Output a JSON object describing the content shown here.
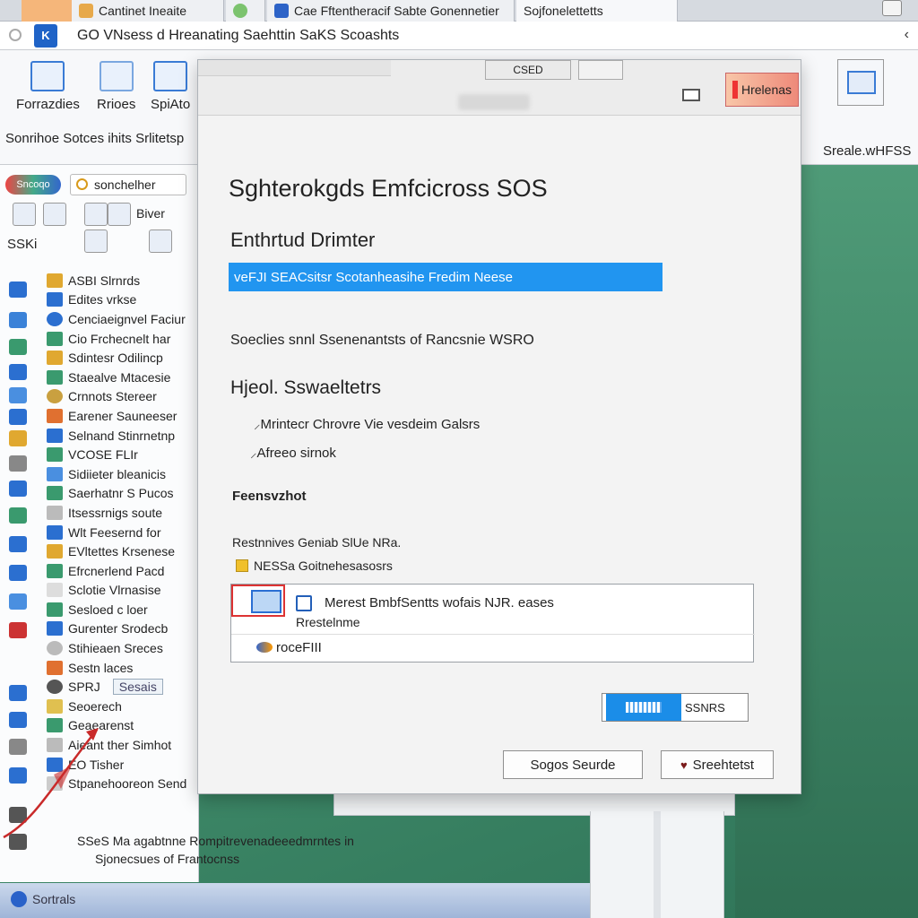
{
  "tabs": [
    {
      "label": "Cantinet Ineaite"
    },
    {
      "label": "Cae Fftentheracif Sabte Gonennetier"
    },
    {
      "label": "Sojfonelettetts"
    }
  ],
  "window": {
    "title": "GO VNsess d Hreanating Saehttin SaKS Scoashts",
    "icon_label": "K"
  },
  "ribbon": {
    "buttons": [
      {
        "label": "Forrazdies"
      },
      {
        "label": "Rrioes"
      },
      {
        "label": "SpiAto"
      }
    ],
    "subtitle": "Sonrihoe Sotces ihits Srlitetsp",
    "right_label": "Sreale.wHFSS"
  },
  "nav": {
    "pill": "Sncoqo",
    "search_text": "sonchelher",
    "tools_label": "SSKi",
    "tool_caption": "Biver",
    "items": [
      {
        "label": "ASBI Slrnrds"
      },
      {
        "label": "Edites vrkse"
      },
      {
        "label": "Cenciaeignvel Faciur"
      },
      {
        "label": "Cio Frchecnelt har"
      },
      {
        "label": "Sdintesr Odilincp"
      },
      {
        "label": "Staealve Mtacesie"
      },
      {
        "label": "Crnnots Stereer"
      },
      {
        "label": "Earener Sauneeser"
      },
      {
        "label": "Selnand Stinrnetnp"
      },
      {
        "label": "VCOSE FLIr"
      },
      {
        "label": "Sidiieter bleanicis"
      },
      {
        "label": "Saerhatnr S Pucos"
      },
      {
        "label": "Itsessrnigs soute"
      },
      {
        "label": "Wlt Feesernd for"
      },
      {
        "label": "EVltettes Krsenese"
      },
      {
        "label": "Efrcnerlend Pacd"
      },
      {
        "label": "Sclotie Vlrnasise"
      },
      {
        "label": "Sesloed c loer"
      },
      {
        "label": "Gurenter Srodecb"
      },
      {
        "label": "Stihieaen Sreces"
      },
      {
        "label": "Sestn laces"
      },
      {
        "label": "SPRJ"
      },
      {
        "label": "Seoerech"
      },
      {
        "label": "Geaearenst"
      },
      {
        "label": "Aieant ther Simhot"
      },
      {
        "label": "EO Tisher"
      },
      {
        "label": "Stpanehooreon Send"
      }
    ],
    "search_box2": "Sesais"
  },
  "footer": {
    "line1": "SSeS Ma agabtnne Rompitrevenadeeedmrntes in",
    "line2": "Sjonecsues of Frantocnss",
    "start_label": "Sortrals"
  },
  "dialog": {
    "tab_b": "CSED",
    "help_button": "Hrelenas",
    "title": "Sghterokgds Emfcicross SOS",
    "heading": "Enthrtud Drimter",
    "highlight": "veFJI SEACsitsr Scotanheasihe Fredim Neese",
    "description": "Soeclies snnl Ssenenantsts of Rancsnie WSRO",
    "section": "Hjeol. Sswaeltetrs",
    "option1": "Mrintecr Chrovre Vie vesdeim Galsrs",
    "option2": "Afreeo sirnok",
    "subheading": "Feensvzhot",
    "small_label": "Restnnives Geniab SlUe NRa.",
    "folder_label": "NESSa Goitnehesasosrs",
    "list_row1": "Merest BmbfSentts wofais NJR. eases",
    "list_row1_sub": "Rrestelnme",
    "list_row2": "roceFIII",
    "browse_label": "SSNRS",
    "cancel_label": "Sogos Seurde",
    "ok_label": "Sreehtetst"
  }
}
